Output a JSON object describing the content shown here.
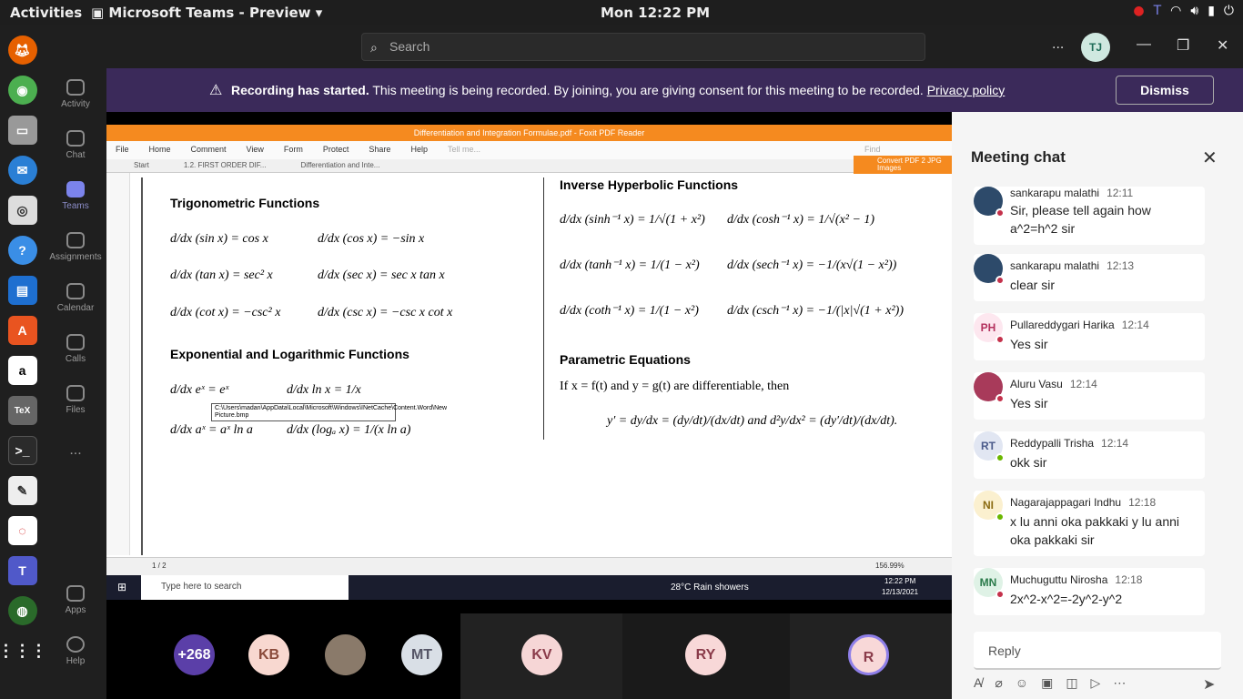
{
  "system": {
    "activities": "Activities",
    "app_name": "Microsoft Teams - Preview",
    "clock": "Mon 12:22 PM"
  },
  "teams": {
    "search_placeholder": "Search",
    "user_initials": "TJ",
    "nav": [
      "Activity",
      "Chat",
      "Teams",
      "Assignments",
      "Calendar",
      "Calls",
      "Files",
      "Apps",
      "Help"
    ],
    "more": "..."
  },
  "banner": {
    "bold": "Recording has started.",
    "text": " This meeting is being recorded. By joining, you are giving consent for this meeting to be recorded. ",
    "link": "Privacy policy",
    "dismiss": "Dismiss"
  },
  "pdf": {
    "title": "Differentiation and Integration Formulae.pdf - Foxit PDF Reader",
    "menu": [
      "File",
      "Home",
      "Comment",
      "View",
      "Form",
      "Protect",
      "Share",
      "Help"
    ],
    "tell_me": "Tell me...",
    "find": "Find",
    "convert": "Convert PDF 2 JPG Images",
    "tabs": [
      "Start",
      "1.2. FIRST ORDER DIF...",
      "Differentiation and Inte..."
    ],
    "headings": {
      "trig": "Trigonometric Functions",
      "exp": "Exponential and Logarithmic Functions",
      "invhyp": "Inverse Hyperbolic Functions",
      "param": "Parametric Equations"
    },
    "trig": [
      "d/dx (sin x) = cos x",
      "d/dx (cos x) = −sin x",
      "d/dx (tan x) = sec² x",
      "d/dx (sec x) = sec x tan x",
      "d/dx (cot x) = −csc² x",
      "d/dx (csc x) = −csc x cot x"
    ],
    "exp": [
      "d/dx eˣ = eˣ",
      "d/dx ln x = 1/x",
      "d/dx aˣ = aˣ ln a",
      "d/dx (logₐ x) = 1/(x ln a)"
    ],
    "invhyp": [
      "d/dx (sinh⁻¹ x) = 1/√(1 + x²)",
      "d/dx (cosh⁻¹ x) = 1/√(x² − 1)",
      "d/dx (tanh⁻¹ x) = 1/(1 − x²)",
      "d/dx (sech⁻¹ x) = −1/(x√(1 − x²))",
      "d/dx (coth⁻¹ x) = 1/(1 − x²)",
      "d/dx (csch⁻¹ x) = −1/(|x|√(1 + x²))"
    ],
    "param_line": "If x = f(t) and y = g(t) are differentiable, then",
    "param_eq": "y′ = dy/dx = (dy/dt)/(dx/dt)     and     d²y/dx² = (dy′/dt)/(dx/dt).",
    "tooltip": "C:\\Users\\madan\\AppData\\Local\\Microsoft\\Windows\\INetCache\\Content.Word\\New Picture.bmp",
    "page": "1 / 2",
    "zoom": "156.99%"
  },
  "winbar": {
    "search": "Type here to search",
    "weather": "28°C  Rain showers",
    "time": "12:22 PM",
    "date": "12/13/2021"
  },
  "participants": [
    "+268",
    "KB",
    "MT",
    "KV",
    "RY",
    "R"
  ],
  "chat": {
    "title": "Meeting chat",
    "reply": "Reply",
    "messages": [
      {
        "initials": "",
        "name": "sankarapu malathi",
        "time": "12:11",
        "body": "Sir, please tell again how a^2=h^2 sir"
      },
      {
        "initials": "",
        "name": "sankarapu malathi",
        "time": "12:13",
        "body": " clear sir"
      },
      {
        "initials": "PH",
        "name": "Pullareddygari Harika",
        "time": "12:14",
        "body": "Yes sir"
      },
      {
        "initials": "",
        "name": "Aluru Vasu",
        "time": "12:14",
        "body": "Yes sir"
      },
      {
        "initials": "RT",
        "name": "Reddypalli Trisha",
        "time": "12:14",
        "body": "okk sir"
      },
      {
        "initials": "NI",
        "name": "Nagarajappagari Indhu",
        "time": "12:18",
        "body": "x lu anni oka pakkaki y lu anni oka pakkaki sir"
      },
      {
        "initials": "MN",
        "name": "Muchuguttu Nirosha",
        "time": "12:18",
        "body": "2x^2-x^2=-2y^2-y^2"
      }
    ]
  }
}
